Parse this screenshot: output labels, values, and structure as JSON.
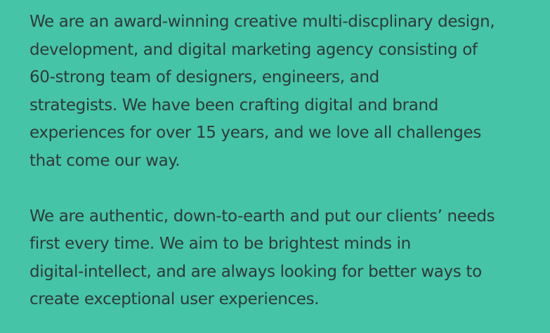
{
  "colors": {
    "background": "#45c4a8",
    "text": "#2f3a37"
  },
  "about": {
    "paragraph_1": {
      "lines": [
        "We are an award-winning creative multi-discplinary design,",
        "development, and digital marketing agency consisting of",
        "60-strong team of designers, engineers, and",
        "strategists. We have been crafting digital and brand",
        "experiences for over 15 years, and we love all challenges",
        "that come our way."
      ]
    },
    "paragraph_2": {
      "lines": [
        "We are authentic, down-to-earth and put our clients’ needs",
        "first every time. We aim to be brightest minds in",
        "digital-intellect, and are always looking for better ways to",
        "create exceptional user experiences."
      ]
    }
  }
}
